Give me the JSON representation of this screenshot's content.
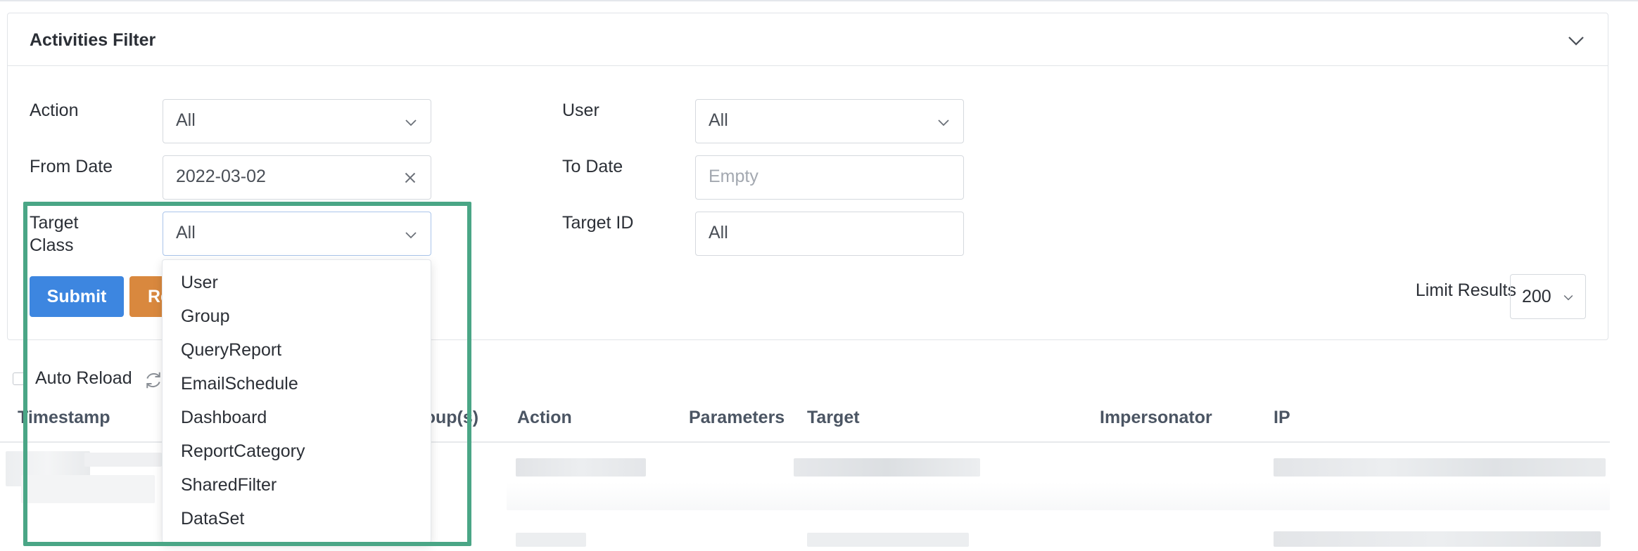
{
  "filter": {
    "title": "Activities Filter",
    "action": {
      "label": "Action",
      "value": "All"
    },
    "user": {
      "label": "User",
      "value": "All"
    },
    "from_date": {
      "label": "From Date",
      "value": "2022-03-02"
    },
    "to_date": {
      "label": "To Date",
      "placeholder": "Empty"
    },
    "target_class": {
      "label_line1": "Target",
      "label_line2": "Class",
      "value": "All"
    },
    "target_id": {
      "label": "Target ID",
      "value": "All"
    },
    "submit_label": "Submit",
    "reset_label": "Re",
    "limit_label": "Limit Results",
    "limit_value": "200"
  },
  "toolbar": {
    "auto_reload_label": "Auto Reload"
  },
  "table": {
    "headers": {
      "timestamp": "Timestamp",
      "groups_partial": "roup(s)",
      "action": "Action",
      "parameters": "Parameters",
      "target": "Target",
      "impersonator": "Impersonator",
      "ip": "IP"
    }
  },
  "dropdown": {
    "options": [
      "User",
      "Group",
      "QueryReport",
      "EmailSchedule",
      "Dashboard",
      "ReportCategory",
      "SharedFilter",
      "DataSet"
    ]
  },
  "colors": {
    "primary": "#3d86e0",
    "warning": "#d9883e",
    "highlight": "#4aa686"
  },
  "icons": {
    "collapse": "chevron-down-icon",
    "clear": "close-icon",
    "refresh": "refresh-icon"
  }
}
